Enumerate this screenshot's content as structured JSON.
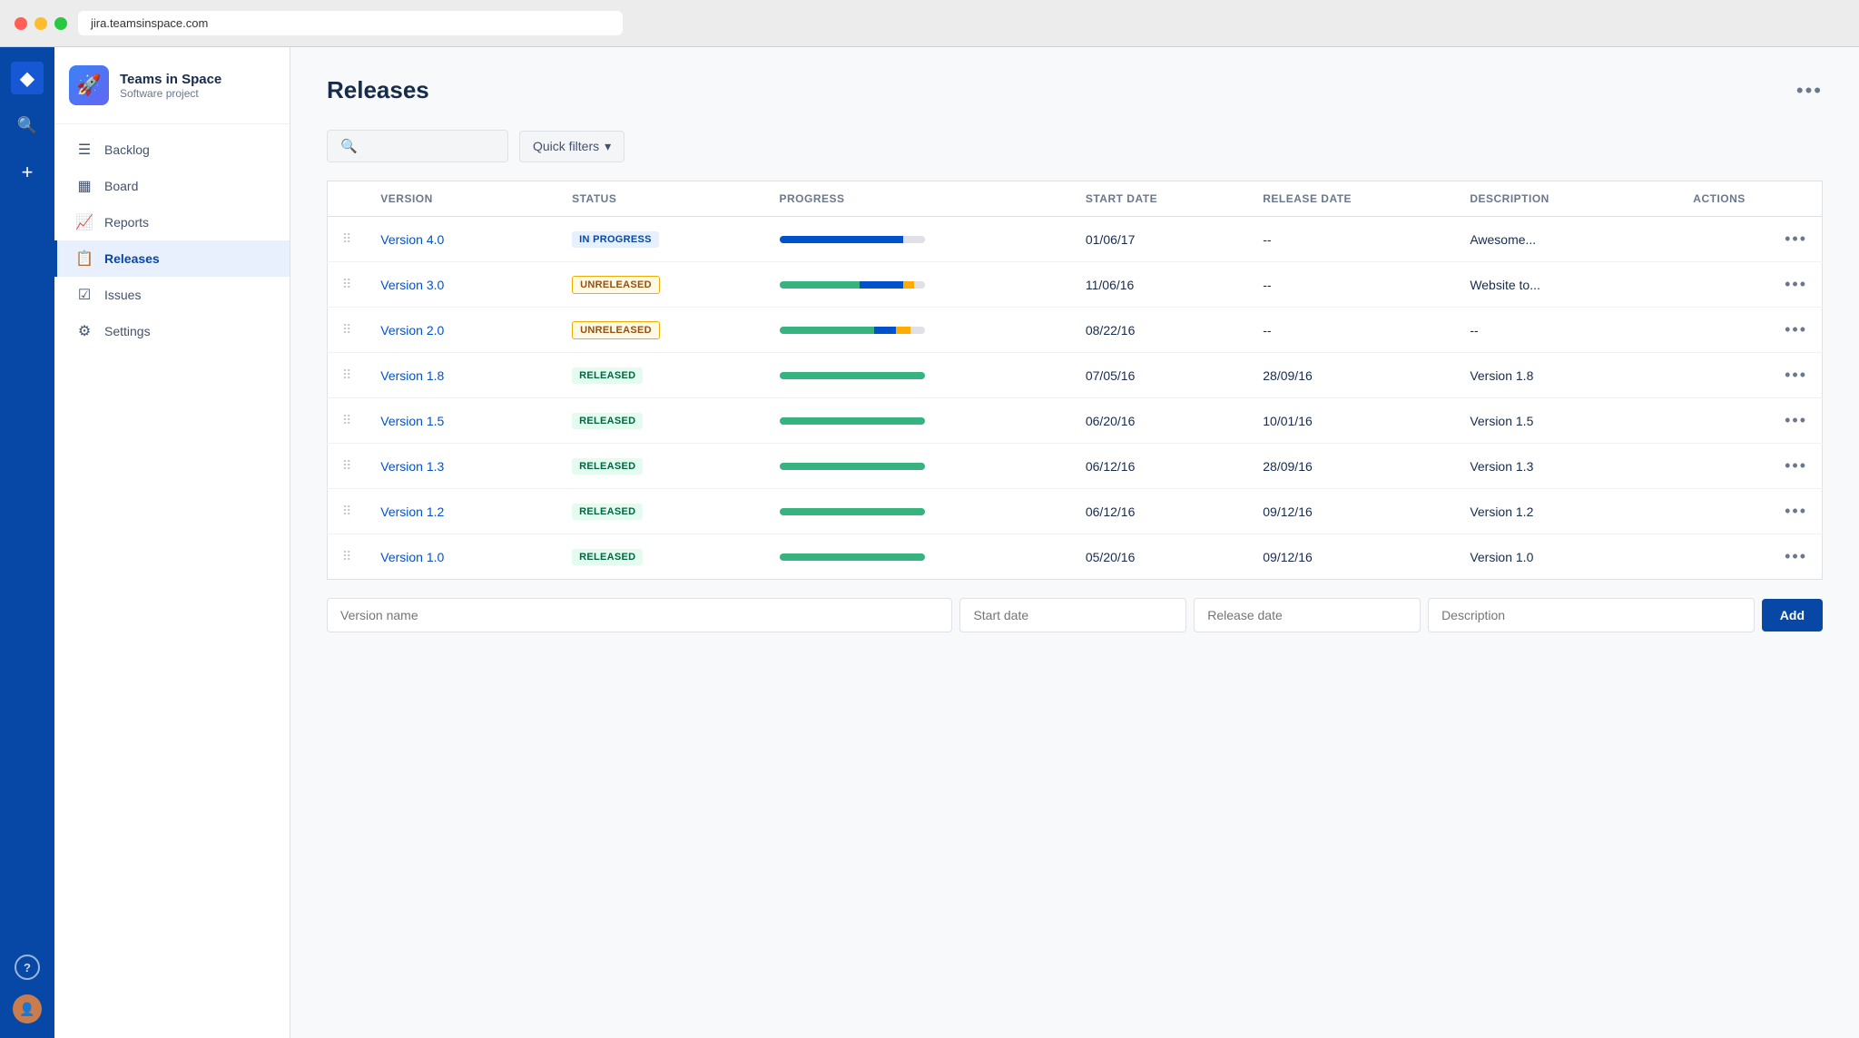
{
  "browser": {
    "url": "jira.teamsinspace.com"
  },
  "global_nav": {
    "logo_symbol": "◆",
    "search_label": "Search",
    "create_label": "Create"
  },
  "sidebar": {
    "project_name": "Teams in Space",
    "project_sub": "Software project",
    "project_emoji": "🚀",
    "nav_items": [
      {
        "id": "backlog",
        "label": "Backlog",
        "icon": "☰"
      },
      {
        "id": "board",
        "label": "Board",
        "icon": "▦"
      },
      {
        "id": "reports",
        "label": "Reports",
        "icon": "📈"
      },
      {
        "id": "releases",
        "label": "Releases",
        "icon": "📋",
        "active": true
      },
      {
        "id": "issues",
        "label": "Issues",
        "icon": "☑"
      },
      {
        "id": "settings",
        "label": "Settings",
        "icon": "⚙"
      }
    ]
  },
  "page": {
    "title": "Releases",
    "more_label": "•••"
  },
  "filters": {
    "search_placeholder": "",
    "quick_filters_label": "Quick filters",
    "chevron": "▾"
  },
  "table": {
    "columns": {
      "drag": "",
      "version": "Version",
      "status": "Status",
      "progress": "Progress",
      "start_date": "Start date",
      "release_date": "Release date",
      "description": "Description",
      "actions": "Actions"
    },
    "rows": [
      {
        "id": "v4",
        "version": "Version 4.0",
        "status": "IN PROGRESS",
        "status_type": "in-progress",
        "progress": {
          "green": 0,
          "blue": 85,
          "yellow": 0,
          "remaining": 15
        },
        "start_date": "01/06/17",
        "release_date": "--",
        "description": "Awesome...",
        "actions": "•••"
      },
      {
        "id": "v3",
        "version": "Version 3.0",
        "status": "UNRELEASED",
        "status_type": "unreleased",
        "progress": {
          "green": 55,
          "blue": 30,
          "yellow": 8,
          "remaining": 7
        },
        "start_date": "11/06/16",
        "release_date": "--",
        "description": "Website to...",
        "actions": "•••"
      },
      {
        "id": "v2",
        "version": "Version 2.0",
        "status": "UNRELEASED",
        "status_type": "unreleased",
        "progress": {
          "green": 65,
          "blue": 15,
          "yellow": 10,
          "remaining": 10
        },
        "start_date": "08/22/16",
        "release_date": "--",
        "description": "--",
        "actions": "•••"
      },
      {
        "id": "v18",
        "version": "Version 1.8",
        "status": "RELEASED",
        "status_type": "released",
        "progress": {
          "green": 100,
          "blue": 0,
          "yellow": 0,
          "remaining": 0
        },
        "start_date": "07/05/16",
        "release_date": "28/09/16",
        "description": "Version 1.8",
        "actions": "•••"
      },
      {
        "id": "v15",
        "version": "Version 1.5",
        "status": "RELEASED",
        "status_type": "released",
        "progress": {
          "green": 100,
          "blue": 0,
          "yellow": 0,
          "remaining": 0
        },
        "start_date": "06/20/16",
        "release_date": "10/01/16",
        "description": "Version 1.5",
        "actions": "•••"
      },
      {
        "id": "v13",
        "version": "Version 1.3",
        "status": "RELEASED",
        "status_type": "released",
        "progress": {
          "green": 100,
          "blue": 0,
          "yellow": 0,
          "remaining": 0
        },
        "start_date": "06/12/16",
        "release_date": "28/09/16",
        "description": "Version 1.3",
        "actions": "•••"
      },
      {
        "id": "v12",
        "version": "Version 1.2",
        "status": "RELEASED",
        "status_type": "released",
        "progress": {
          "green": 100,
          "blue": 0,
          "yellow": 0,
          "remaining": 0
        },
        "start_date": "06/12/16",
        "release_date": "09/12/16",
        "description": "Version 1.2",
        "actions": "•••"
      },
      {
        "id": "v10",
        "version": "Version 1.0",
        "status": "RELEASED",
        "status_type": "released",
        "progress": {
          "green": 100,
          "blue": 0,
          "yellow": 0,
          "remaining": 0
        },
        "start_date": "05/20/16",
        "release_date": "09/12/16",
        "description": "Version 1.0",
        "actions": "•••"
      }
    ]
  },
  "add_version": {
    "version_placeholder": "Version name",
    "start_date_placeholder": "Start date",
    "release_date_placeholder": "Release date",
    "description_placeholder": "Description",
    "add_button_label": "Add"
  }
}
